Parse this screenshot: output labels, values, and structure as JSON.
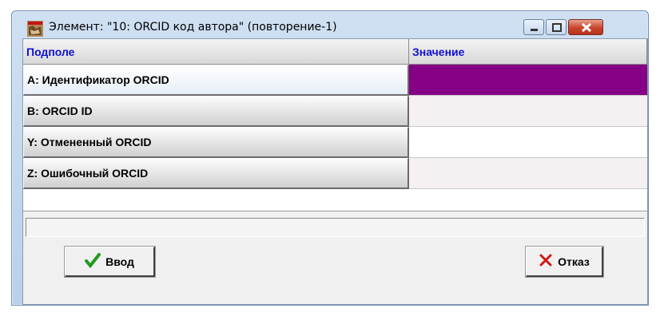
{
  "window": {
    "title": "Элемент: \"10: ORCID код автора\" (повторение-1)",
    "icon": "app-logo-icon",
    "controls": [
      "minimize-icon",
      "maximize-icon",
      "close-icon"
    ]
  },
  "grid": {
    "columns": [
      "Подполе",
      "Значение"
    ],
    "rows": [
      {
        "label": "A: Идентификатор ORCID",
        "value": "",
        "selected": true
      },
      {
        "label": "B: ORCID ID",
        "value": ""
      },
      {
        "label": "Y: Отмененный ORCID",
        "value": ""
      },
      {
        "label": "Z: Ошибочный ORCID",
        "value": ""
      }
    ]
  },
  "status": {
    "text": ""
  },
  "buttons": {
    "ok_label": "Ввод",
    "ok_icon": "checkmark-icon",
    "cancel_label": "Отказ",
    "cancel_icon": "x-cross-icon"
  },
  "colors": {
    "header_text": "#1010d8",
    "selected_cell": "#850085",
    "alt_cell": "#f5f0f1",
    "cell": "#ffffff"
  }
}
